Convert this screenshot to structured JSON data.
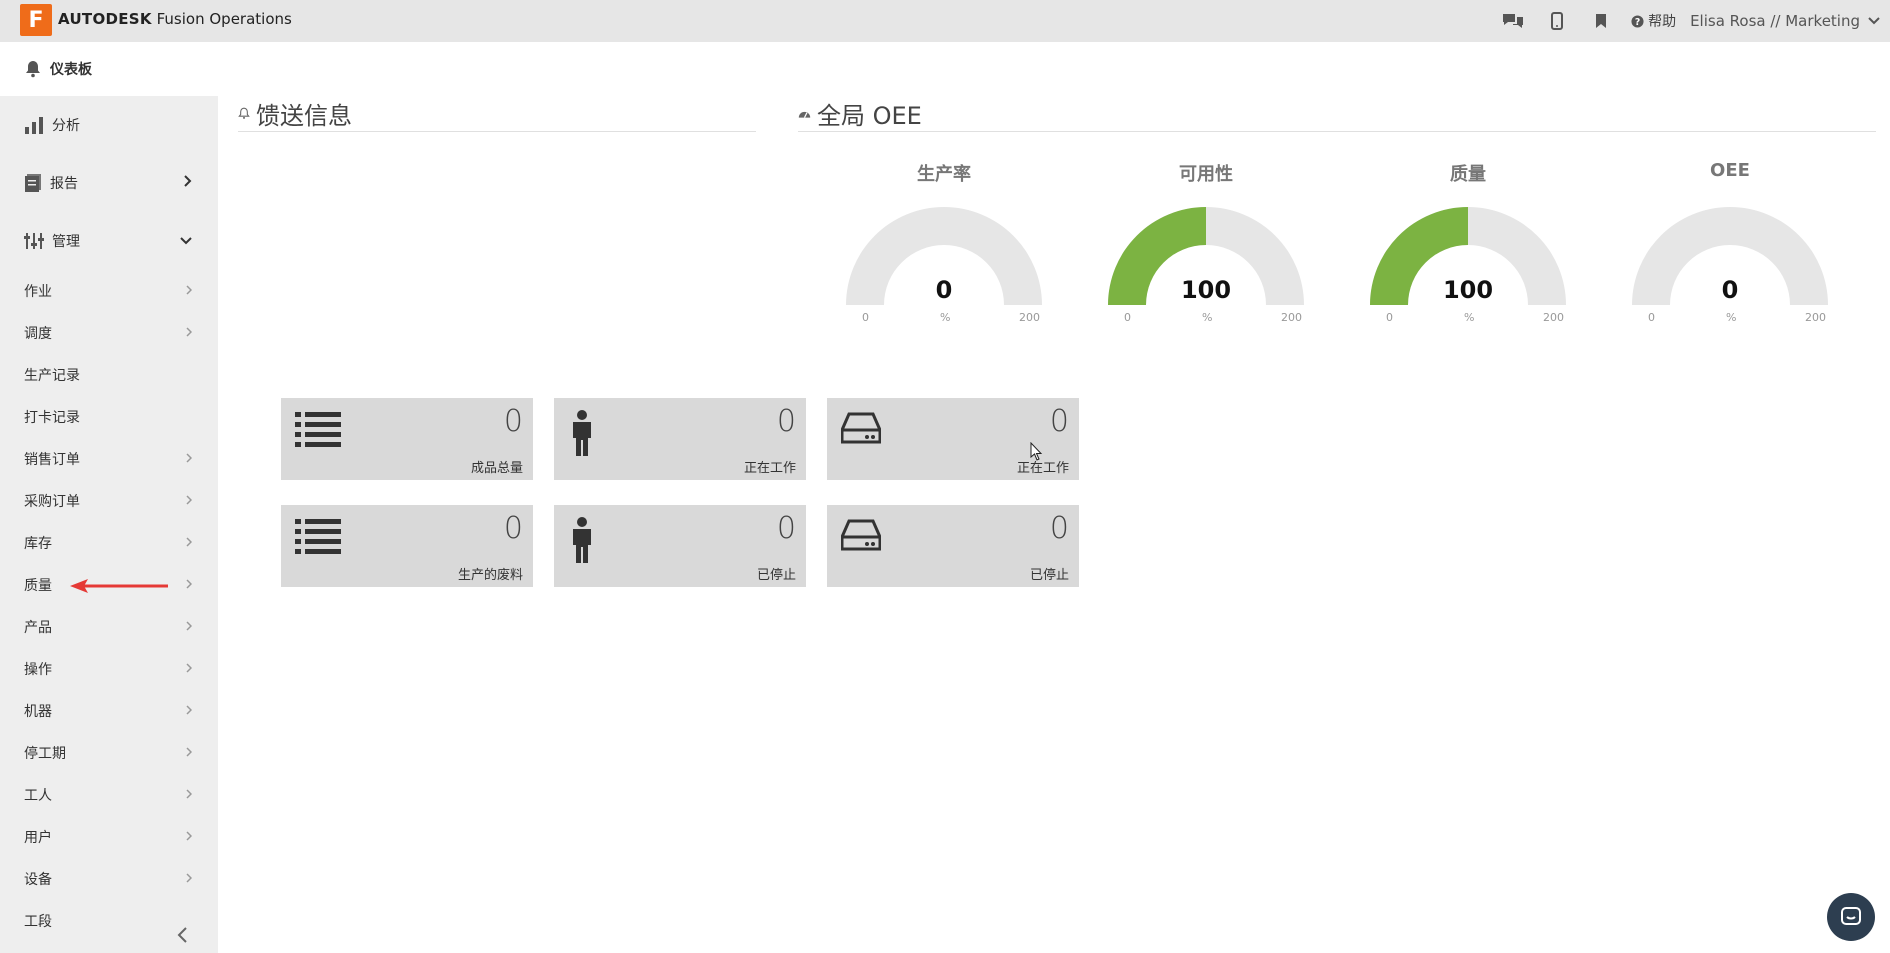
{
  "topbar": {
    "logo_letter": "F",
    "brand_bold": "AUTODESK",
    "brand_rest": " Fusion Operations",
    "help_label": "帮助",
    "user_label": "Elisa Rosa // Marketing",
    "icons": [
      "chat-icon",
      "mobile-icon",
      "bookmark-icon",
      "help-icon",
      "chevron-down-icon"
    ]
  },
  "sidebar": {
    "dashboard": "仪表板",
    "analysis": "分析",
    "reports": "报告",
    "manage": "管理",
    "items": [
      {
        "label": "作业",
        "chevron": true
      },
      {
        "label": "调度",
        "chevron": true
      },
      {
        "label": "生产记录",
        "chevron": false
      },
      {
        "label": "打卡记录",
        "chevron": false
      },
      {
        "label": "销售订单",
        "chevron": true
      },
      {
        "label": "采购订单",
        "chevron": true
      },
      {
        "label": "库存",
        "chevron": true
      },
      {
        "label": "质量",
        "chevron": true
      },
      {
        "label": "产品",
        "chevron": true
      },
      {
        "label": "操作",
        "chevron": true
      },
      {
        "label": "机器",
        "chevron": true
      },
      {
        "label": "停工期",
        "chevron": true
      },
      {
        "label": "工人",
        "chevron": true
      },
      {
        "label": "用户",
        "chevron": true
      },
      {
        "label": "设备",
        "chevron": true
      },
      {
        "label": "工段",
        "chevron": false
      }
    ]
  },
  "feed": {
    "title": "馈送信息"
  },
  "oee": {
    "title": "全局 OEE",
    "gauges": [
      {
        "label": "生产率",
        "value": 0,
        "display": "0",
        "unit": "%",
        "min": "0",
        "max": "200"
      },
      {
        "label": "可用性",
        "value": 100,
        "display": "100",
        "unit": "%",
        "min": "0",
        "max": "200"
      },
      {
        "label": "质量",
        "value": 100,
        "display": "100",
        "unit": "%",
        "min": "0",
        "max": "200"
      },
      {
        "label": "OEE",
        "value": 0,
        "display": "0",
        "unit": "%",
        "min": "0",
        "max": "200"
      }
    ],
    "gauge_fill_color": "#7cb342",
    "gauge_track_color": "#e6e6e6"
  },
  "tiles": [
    {
      "icon": "list-icon",
      "value": "0",
      "label": "成品总量"
    },
    {
      "icon": "person-icon",
      "value": "0",
      "label": "正在工作"
    },
    {
      "icon": "hard-drive-icon",
      "value": "0",
      "label": "正在工作"
    },
    {
      "icon": "list-icon",
      "value": "0",
      "label": "生产的废料"
    },
    {
      "icon": "person-icon",
      "value": "0",
      "label": "已停止"
    },
    {
      "icon": "hard-drive-icon",
      "value": "0",
      "label": "已停止"
    }
  ]
}
